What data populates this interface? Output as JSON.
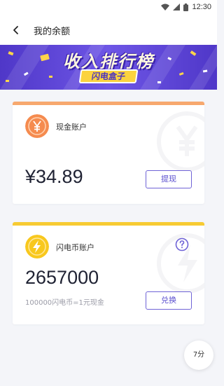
{
  "status_bar": {
    "time": "12:30",
    "icons": [
      "wifi-icon",
      "signal-icon",
      "battery-icon"
    ]
  },
  "app_bar": {
    "title": "我的余额",
    "back_icon": "back-arrow-icon"
  },
  "banner": {
    "headline": "收入排行榜",
    "brand": "闪电盒子",
    "colors": {
      "bg": "#5a41d6",
      "badge": "#fbd33f"
    }
  },
  "cash_account": {
    "label": "现金账户",
    "icon": "yuan-coin-icon",
    "amount": "¥34.89",
    "button": "提现",
    "accent": "#f7a86e"
  },
  "coin_account": {
    "label": "闪电币账户",
    "icon": "lightning-coin-icon",
    "help_icon": "question-circle-icon",
    "amount": "2657000",
    "rate_note": "100000闪电币=1元现金",
    "button": "兑换",
    "accent": "#f7cb33"
  },
  "timer": {
    "label": "7分"
  }
}
